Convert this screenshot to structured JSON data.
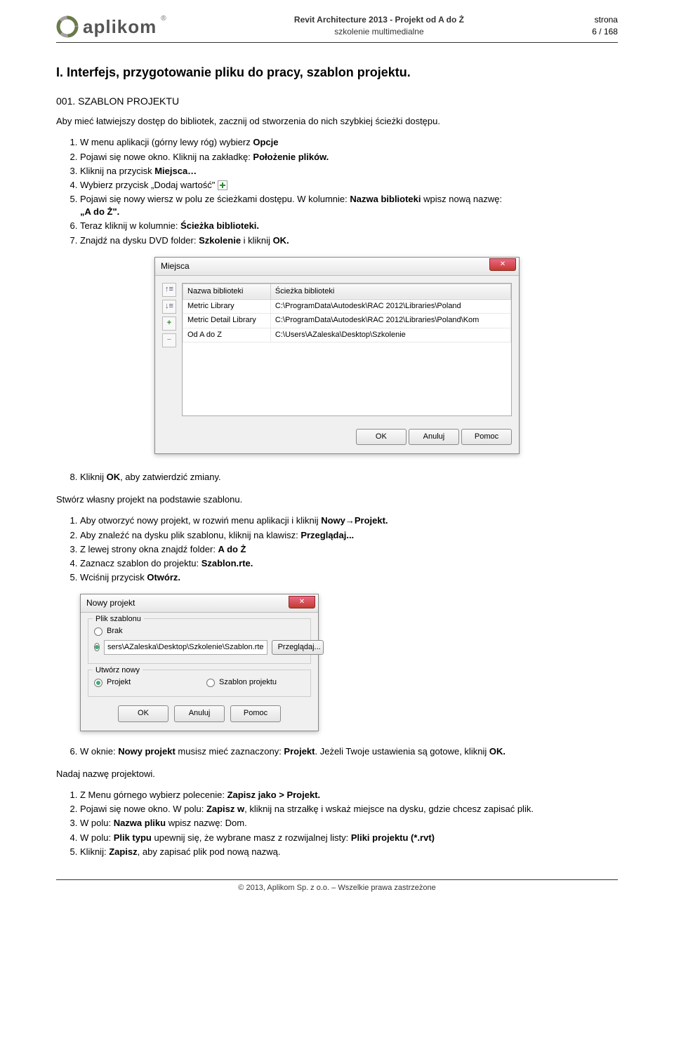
{
  "header": {
    "logo_text": "aplikom",
    "center_line1": "Revit Architecture 2013 - Projekt od A do Ż",
    "center_line2": "szkolenie multimedialne",
    "right_line1": "strona",
    "right_line2": "6 / 168"
  },
  "h1": "I.    Interfejs, przygotowanie pliku do pracy, szablon projektu.",
  "sub1": "001.  SZABLON PROJEKTU",
  "intro": "Aby mieć łatwiejszy dostęp do bibliotek, zacznij od stworzenia do nich szybkiej ścieżki dostępu.",
  "list1": {
    "i1a": "W menu aplikacji (górny lewy róg) wybierz ",
    "i1b": "Opcje",
    "i2a": "Pojawi się nowe okno. Kliknij na zakładkę: ",
    "i2b": "Położenie plików.",
    "i3a": "Kliknij na przycisk ",
    "i3b": "Miejsca…",
    "i4a": "Wybierz przycisk „Dodaj wartość\" ",
    "i5a": "Pojawi się nowy wiersz w polu ze ścieżkami dostępu. W kolumnie: ",
    "i5b": "Nazwa biblioteki",
    "i5c": " wpisz nową nazwę:",
    "i5d": "„A do Ż\".",
    "i6a": "Teraz kliknij w kolumnie: ",
    "i6b": "Ścieżka biblioteki.",
    "i7a": "Znajdź na dysku DVD folder: ",
    "i7b": "Szkolenie",
    "i7c": " i kliknij ",
    "i7d": "OK."
  },
  "dialog1": {
    "title": "Miejsca",
    "col1": "Nazwa biblioteki",
    "col2": "Ścieżka biblioteki",
    "rows": [
      {
        "name": "Metric Library",
        "path": "C:\\ProgramData\\Autodesk\\RAC 2012\\Libraries\\Poland"
      },
      {
        "name": "Metric Detail Library",
        "path": "C:\\ProgramData\\Autodesk\\RAC 2012\\Libraries\\Poland\\Kom"
      },
      {
        "name": "Od A do Z",
        "path": "C:\\Users\\AZaleska\\Desktop\\Szkolenie"
      }
    ],
    "ok": "OK",
    "cancel": "Anuluj",
    "help": "Pomoc"
  },
  "list1b": {
    "i8a": "Kliknij ",
    "i8b": "OK",
    "i8c": ", aby zatwierdzić zmiany."
  },
  "para2": "Stwórz własny projekt na podstawie szablonu.",
  "list2": {
    "i1a": "Aby otworzyć nowy projekt, w rozwiń menu aplikacji i kliknij ",
    "i1b": "Nowy→Projekt.",
    "i2a": "Aby znaleźć na dysku plik szablonu, kliknij na klawisz: ",
    "i2b": "Przeglądaj...",
    "i3a": "Z lewej strony okna znajdź folder: ",
    "i3b": "A do Ż",
    "i4a": "Zaznacz szablon do projektu: ",
    "i4b": "Szablon.rte.",
    "i5a": "Wciśnij przycisk ",
    "i5b": "Otwórz."
  },
  "dialog2": {
    "title": "Nowy projekt",
    "fs1_legend": "Plik szablonu",
    "r1_label": "Brak",
    "input_value": "sers\\AZaleska\\Desktop\\Szkolenie\\Szablon.rte",
    "browse": "Przeglądaj...",
    "fs2_legend": "Utwórz nowy",
    "r3_label": "Projekt",
    "r4_label": "Szablon projektu",
    "ok": "OK",
    "cancel": "Anuluj",
    "help": "Pomoc"
  },
  "list2b": {
    "i6a": "W oknie: ",
    "i6b": "Nowy projekt",
    "i6c": " musisz mieć zaznaczony: ",
    "i6d": "Projekt",
    "i6e": ". Jeżeli Twoje ustawienia są gotowe, kliknij ",
    "i6f": "OK."
  },
  "para3": "Nadaj nazwę projektowi.",
  "list3": {
    "i1a": "Z Menu górnego wybierz polecenie: ",
    "i1b": "Zapisz jako > Projekt.",
    "i2a": "Pojawi się nowe okno. W polu: ",
    "i2b": "Zapisz w",
    "i2c": ", kliknij na strzałkę i wskaż miejsce na dysku, gdzie chcesz zapisać plik.",
    "i3a": "W polu: ",
    "i3b": "Nazwa pliku",
    "i3c": " wpisz nazwę: Dom.",
    "i4a": "W polu: ",
    "i4b": "Plik typu",
    "i4c": " upewnij się, że wybrane masz z rozwijalnej listy: ",
    "i4d": "Pliki projektu (*.rvt)",
    "i5a": "Kliknij: ",
    "i5b": "Zapisz",
    "i5c": ", aby zapisać plik pod nową nazwą."
  },
  "footer": "© 2013, Aplikom Sp. z o.o. – Wszelkie prawa zastrzeżone"
}
